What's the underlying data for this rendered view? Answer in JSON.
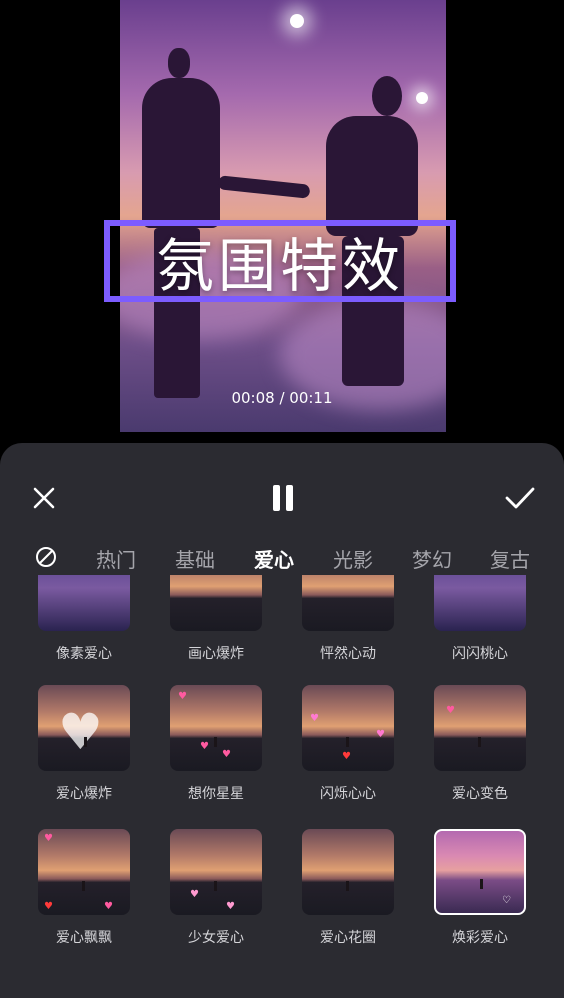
{
  "preview": {
    "title_text": "氛围特效",
    "time": "00:08 / 00:11"
  },
  "toolbar": {
    "close_icon": "close-icon",
    "pause_icon": "pause-icon",
    "confirm_icon": "check-icon"
  },
  "tabs": [
    "热门",
    "基础",
    "爱心",
    "光影",
    "梦幻",
    "复古"
  ],
  "active_tab": "爱心",
  "effects": [
    {
      "label": "像素爱心"
    },
    {
      "label": "画心爆炸"
    },
    {
      "label": "怦然心动"
    },
    {
      "label": "闪闪桃心"
    },
    {
      "label": "爱心爆炸"
    },
    {
      "label": "想你星星"
    },
    {
      "label": "闪烁心心"
    },
    {
      "label": "爱心变色"
    },
    {
      "label": "爱心飘飘"
    },
    {
      "label": "少女爱心"
    },
    {
      "label": "爱心花圈"
    },
    {
      "label": "焕彩爱心"
    }
  ],
  "selected_effect": "焕彩爱心",
  "colors": {
    "accent": "#7c5cff",
    "panel": "#2b2b31",
    "heart": "#ff5aa0"
  }
}
